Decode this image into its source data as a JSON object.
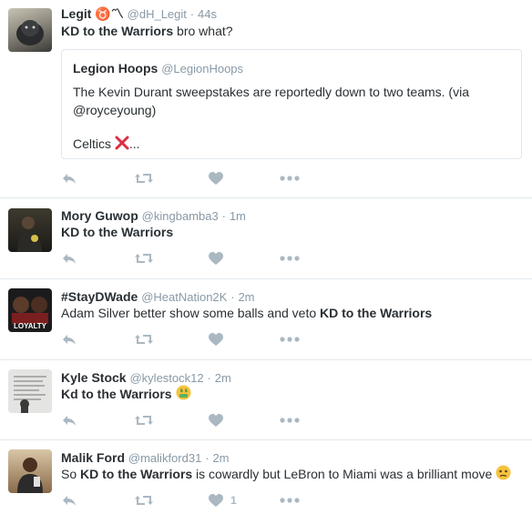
{
  "tweets": [
    {
      "name": "Legit ♉〽",
      "handle": "@dH_Legit",
      "sep": "·",
      "time": "44s",
      "text_bold": "KD to the Warriors",
      "text_after": " bro what?",
      "quote": {
        "name": "Legion Hoops",
        "handle": "@LegionHoops",
        "line1": "The Kevin Durant sweepstakes are reportedly down to two teams. (via",
        "line2": "@royceyoung)",
        "line3_text": "Celtics ",
        "line3_tail": "..."
      }
    },
    {
      "name": "Mory Guwop",
      "handle": "@kingbamba3",
      "sep": "·",
      "time": "1m",
      "text_bold": "KD to the Warriors"
    },
    {
      "name": "#StayDWade",
      "handle": "@HeatNation2K",
      "sep": "·",
      "time": "2m",
      "text_before": "Adam Silver better show some balls and veto ",
      "text_bold": "KD to the Warriors",
      "avatar_caption": "LOYALTY"
    },
    {
      "name": "Kyle Stock",
      "handle": "@kylestock12",
      "sep": "·",
      "time": "2m",
      "text_bold": "Kd to the Warriors",
      "text_after": " "
    },
    {
      "name": "Malik Ford",
      "handle": "@malikford31",
      "sep": "·",
      "time": "2m",
      "text_before": "So ",
      "text_bold": "KD to the Warriors",
      "text_after": " is cowardly but LeBron to Miami was a brilliant move ",
      "like_count": "1"
    }
  ],
  "icons": [
    "reply-icon",
    "retweet-icon",
    "like-icon",
    "more-icon",
    "red-x-icon",
    "money-mouth-emoji",
    "confused-emoji"
  ],
  "colors": {
    "muted": "#8899a6",
    "icon": "#aab8c2",
    "text": "#292f33",
    "border": "#e1e8ed",
    "red_x": "#dd2e44"
  }
}
